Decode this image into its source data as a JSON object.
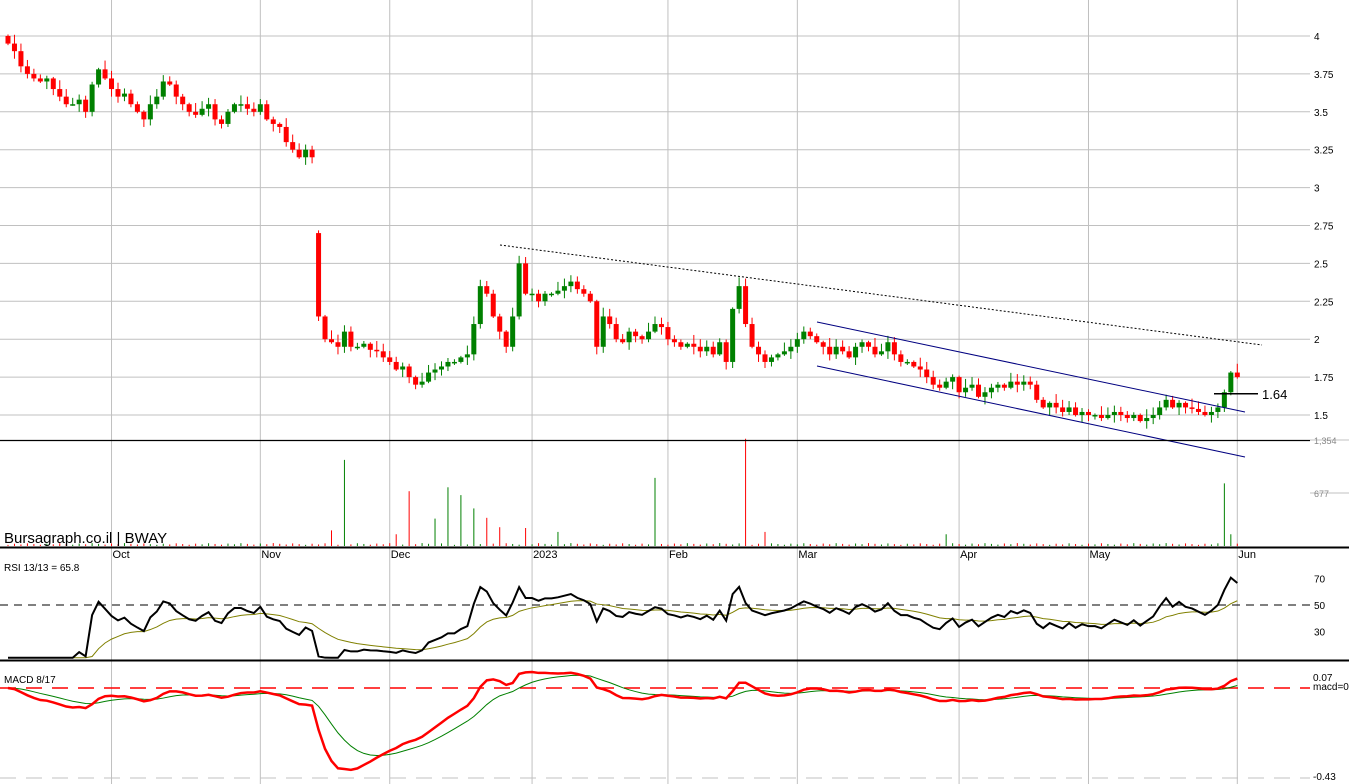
{
  "chart_data": {
    "type": "candlestick",
    "title": "Bursagraph.co.il | BWAY",
    "x_labels": [
      {
        "label": "Oct",
        "index": 16
      },
      {
        "label": "Nov",
        "index": 39
      },
      {
        "label": "Dec",
        "index": 59
      },
      {
        "label": "2023",
        "index": 81
      },
      {
        "label": "Feb",
        "index": 102
      },
      {
        "label": "Mar",
        "index": 122
      },
      {
        "label": "Apr",
        "index": 147
      },
      {
        "label": "May",
        "index": 167
      },
      {
        "label": "Jun",
        "index": 190
      }
    ],
    "price_ticks": [
      "4",
      "3.75",
      "3.5",
      "3.25",
      "3",
      "2.75",
      "2.5",
      "2.25",
      "2",
      "1.75",
      "1.5"
    ],
    "price_tick_values": [
      4,
      3.75,
      3.5,
      3.25,
      3,
      2.75,
      2.5,
      2.25,
      2,
      1.75,
      1.5
    ],
    "price_range": [
      1.33,
      4.06
    ],
    "closes": [
      3.95,
      3.9,
      3.8,
      3.75,
      3.72,
      3.7,
      3.72,
      3.65,
      3.6,
      3.55,
      3.55,
      3.58,
      3.5,
      3.68,
      3.78,
      3.72,
      3.65,
      3.6,
      3.62,
      3.55,
      3.5,
      3.45,
      3.55,
      3.6,
      3.7,
      3.68,
      3.6,
      3.55,
      3.5,
      3.48,
      3.52,
      3.55,
      3.45,
      3.42,
      3.5,
      3.55,
      3.55,
      3.52,
      3.5,
      3.55,
      3.45,
      3.42,
      3.4,
      3.3,
      3.25,
      3.2,
      3.25,
      3.2,
      2.15,
      2.0,
      1.98,
      1.95,
      2.05,
      1.95,
      1.95,
      1.97,
      1.93,
      1.92,
      1.88,
      1.85,
      1.8,
      1.82,
      1.75,
      1.7,
      1.72,
      1.78,
      1.8,
      1.82,
      1.85,
      1.85,
      1.88,
      1.9,
      2.1,
      2.35,
      2.3,
      2.15,
      2.05,
      1.95,
      2.15,
      2.5,
      2.3,
      2.3,
      2.25,
      2.3,
      2.3,
      2.32,
      2.35,
      2.38,
      2.33,
      2.3,
      2.25,
      1.95,
      2.15,
      2.1,
      2.0,
      1.98,
      2.05,
      2.02,
      2.0,
      2.05,
      2.1,
      2.08,
      2.0,
      1.98,
      1.95,
      1.97,
      1.95,
      1.92,
      1.95,
      1.9,
      1.98,
      1.85,
      2.2,
      2.35,
      2.1,
      1.95,
      1.9,
      1.85,
      1.88,
      1.9,
      1.92,
      1.95,
      2.0,
      2.05,
      2.02,
      1.98,
      1.95,
      1.9,
      1.95,
      1.92,
      1.88,
      1.95,
      1.98,
      1.95,
      1.9,
      1.92,
      1.98,
      1.9,
      1.85,
      1.85,
      1.82,
      1.8,
      1.75,
      1.7,
      1.68,
      1.72,
      1.75,
      1.65,
      1.68,
      1.7,
      1.62,
      1.65,
      1.68,
      1.7,
      1.68,
      1.72,
      1.7,
      1.72,
      1.7,
      1.6,
      1.55,
      1.58,
      1.55,
      1.52,
      1.55,
      1.5,
      1.52,
      1.5,
      1.5,
      1.48,
      1.5,
      1.52,
      1.5,
      1.48,
      1.5,
      1.46,
      1.48,
      1.5,
      1.55,
      1.6,
      1.55,
      1.58,
      1.55,
      1.54,
      1.52,
      1.5,
      1.52,
      1.55,
      1.65,
      1.78,
      1.75
    ],
    "first_open": 4.0,
    "volume_ticks": [
      "1,354",
      "677"
    ],
    "volume_tick_values": [
      1354,
      677
    ],
    "volume_spikes": [
      [
        50,
        200
      ],
      [
        52,
        1100
      ],
      [
        60,
        150
      ],
      [
        62,
        700
      ],
      [
        66,
        350
      ],
      [
        68,
        750
      ],
      [
        70,
        650
      ],
      [
        72,
        480
      ],
      [
        74,
        360
      ],
      [
        76,
        240
      ],
      [
        80,
        230
      ],
      [
        85,
        180
      ],
      [
        100,
        870
      ],
      [
        114,
        1370
      ],
      [
        117,
        180
      ],
      [
        145,
        150
      ],
      [
        188,
        800
      ],
      [
        189,
        150
      ]
    ],
    "annotations": {
      "level_label": "1.64",
      "level_value": 1.64
    },
    "rsi": {
      "label": "RSI 13/13 = 65.8",
      "ticks": [
        "70",
        "50",
        "30"
      ],
      "tick_values": [
        70,
        50,
        30
      ],
      "period": 13
    },
    "macd": {
      "label": "MACD 8/17",
      "top_label": "0.07",
      "zero_label": "macd=0",
      "bottom_label": "-0.43",
      "range": [
        -0.43,
        0.07
      ],
      "fast": 8,
      "slow": 17
    }
  },
  "colors": {
    "up": "#008000",
    "down": "#ff0000",
    "grid": "#c0c0c0",
    "channel": "#000080",
    "rsi_signal": "#808000"
  }
}
